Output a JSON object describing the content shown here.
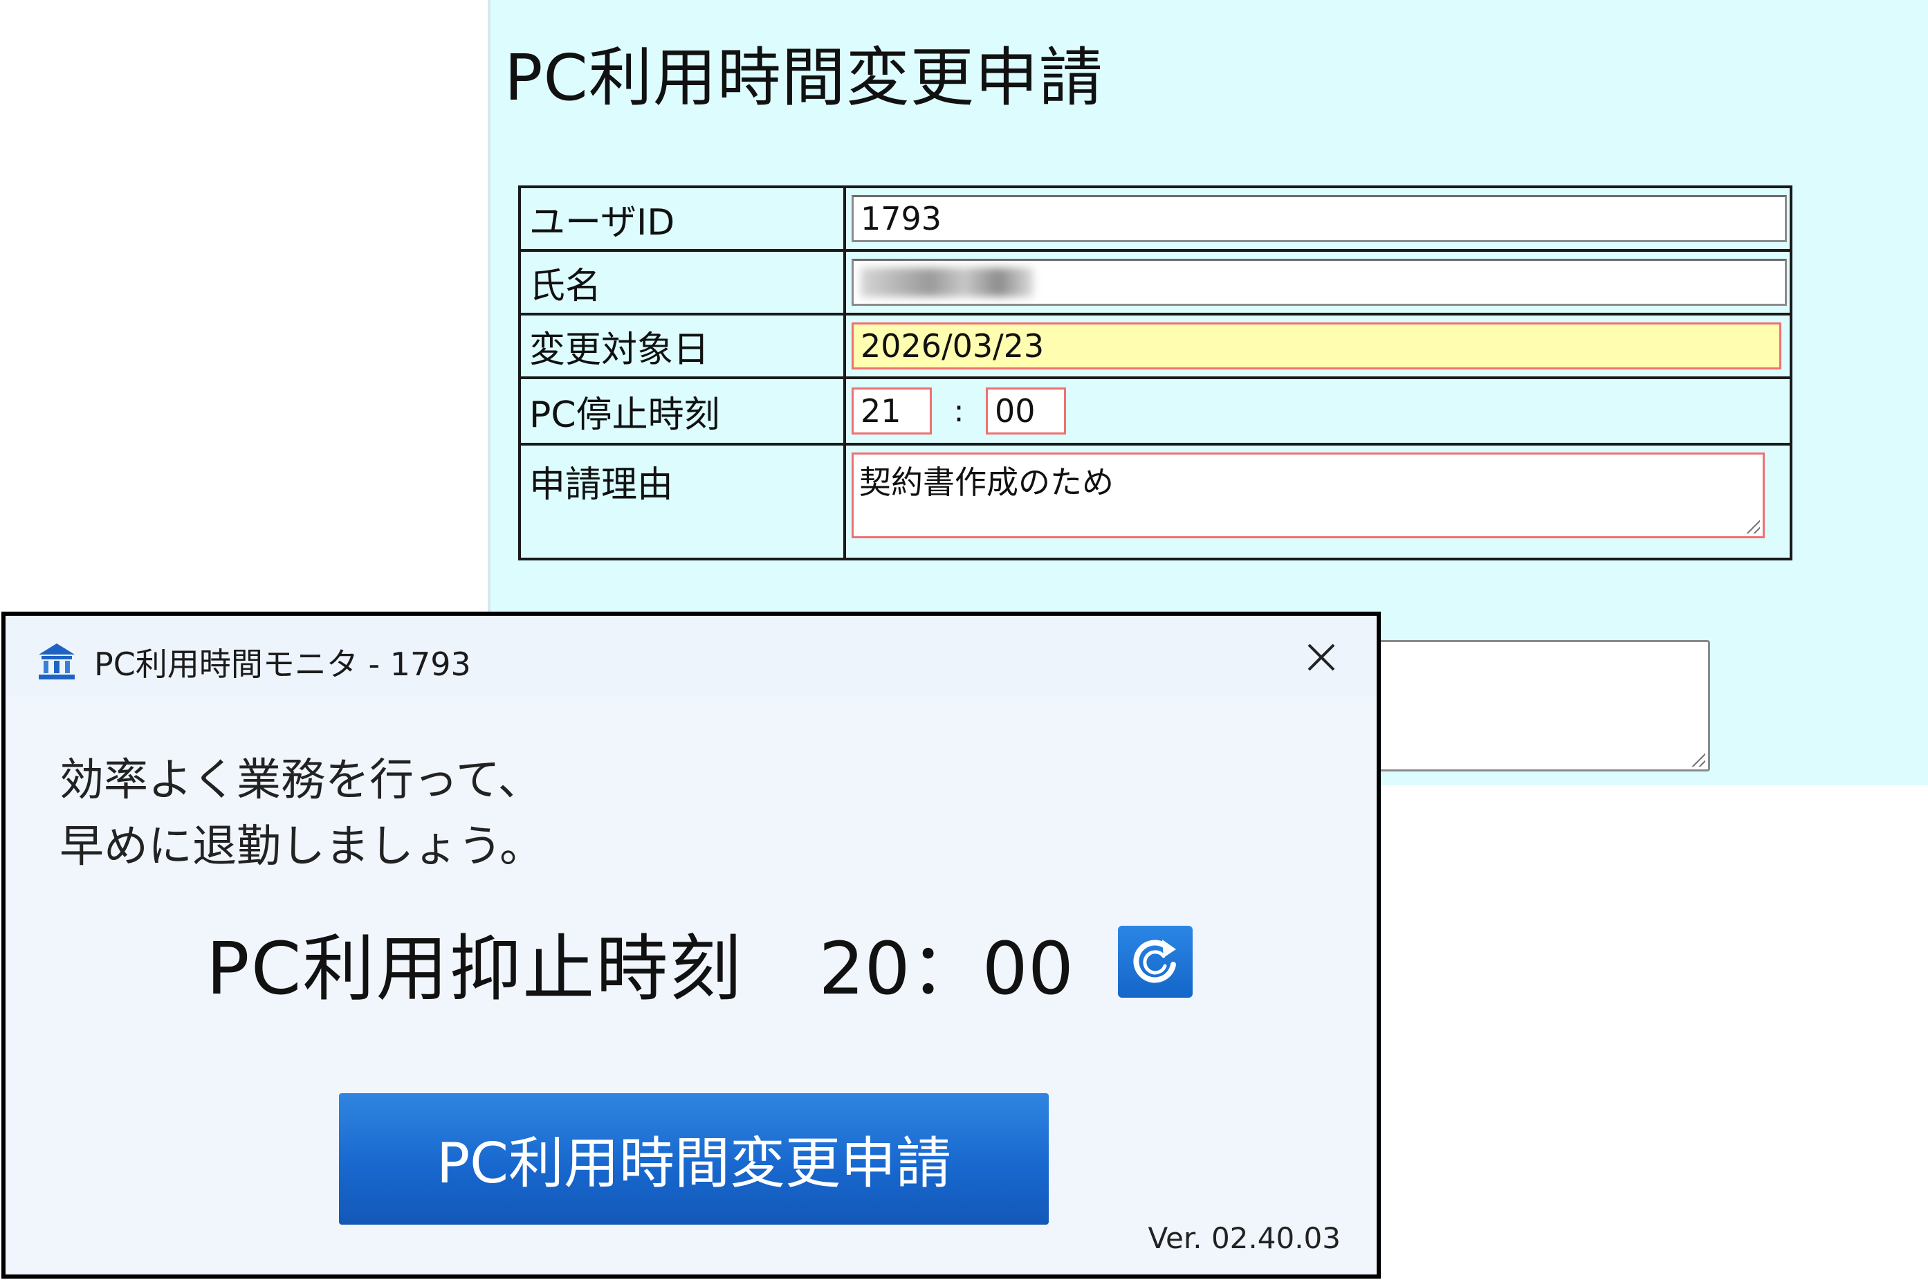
{
  "web_form": {
    "title": "PC利用時間変更申請",
    "rows": {
      "user_id": {
        "label": "ユーザID",
        "value": "1793"
      },
      "name": {
        "label": "氏名"
      },
      "target_date": {
        "label": "変更対象日",
        "value": "2026/03/23"
      },
      "stop_time": {
        "label": "PC停止時刻",
        "hour": "21",
        "separator": ":",
        "minute": "00"
      },
      "reason": {
        "label": "申請理由",
        "value": "契約書作成のため"
      }
    }
  },
  "monitor_window": {
    "title": "PC利用時間モニタ - 1793",
    "message_line1": "効率よく業務を行って、",
    "message_line2": "早めに退勤しましょう。",
    "stop_label": "PC利用抑止時刻",
    "stop_time": "20：00",
    "apply_button": "PC利用時間変更申請",
    "version": "Ver. 02.40.03",
    "icons": {
      "app": "building-icon",
      "close": "close-icon",
      "refresh": "refresh-icon"
    }
  },
  "colors": {
    "form_background": "#ddfcfd",
    "date_field_background": "#fffdb0",
    "required_border": "#f07070",
    "button_blue": "#1868cf",
    "window_background": "#f0f6fc"
  }
}
